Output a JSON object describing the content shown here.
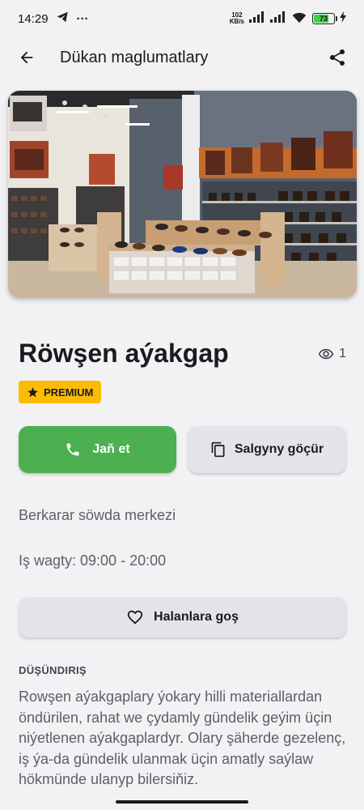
{
  "status_bar": {
    "time": "14:29",
    "more": "···",
    "net_speed_value": "102",
    "net_speed_unit": "KB/s",
    "battery": "73"
  },
  "app_bar": {
    "title": "Dükan maglumatlary"
  },
  "shop": {
    "title": "Röwşen aýakgap",
    "views": "1",
    "badge": "PREMIUM",
    "location": "Berkarar söwda merkezi",
    "hours": "Iş wagty: 09:00 - 20:00"
  },
  "actions": {
    "call_label": "Jaň et",
    "copy_label": "Salgyny göçür",
    "favorite_label": "Halanlara goş"
  },
  "description": {
    "heading": "DÜŞÜNDIRIŞ",
    "text": "Rowşen aýakgaplary ýokary hilli materiallardan öndürilen, rahat we çydamly gündelik geýim üçin niýetlenen aýakgaplardyr. Olary şäherde gezelenç, iş ýa-da gündelik ulanmak üçin amatly saýlaw hökmünde ulanyp bilersiňiz."
  },
  "colors": {
    "call_button": "#4caf50",
    "badge": "#fbbc05",
    "secondary_button": "#e4e3ea",
    "background": "#f2f2f4"
  },
  "icons": {
    "back": "arrow-back-icon",
    "share": "share-icon",
    "views": "eye-icon",
    "star": "star-icon",
    "phone": "phone-icon",
    "copy": "copy-icon",
    "heart": "heart-outline-icon"
  }
}
